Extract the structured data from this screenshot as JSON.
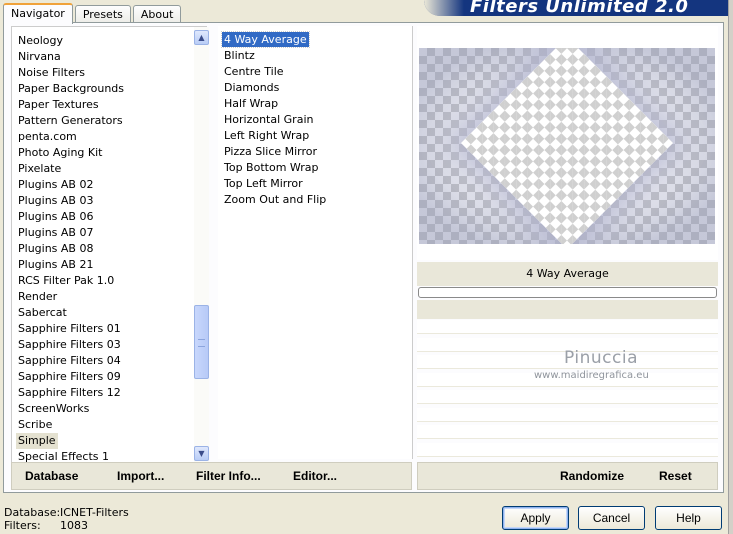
{
  "banner": {
    "title": "Filters Unlimited 2.0"
  },
  "tabs": [
    {
      "label": "Navigator"
    },
    {
      "label": "Presets"
    },
    {
      "label": "About"
    }
  ],
  "categories": {
    "items": [
      "Neology",
      "Nirvana",
      "Noise Filters",
      "Paper Backgrounds",
      "Paper Textures",
      "Pattern Generators",
      "penta.com",
      "Photo Aging Kit",
      "Pixelate",
      "Plugins AB 02",
      "Plugins AB 03",
      "Plugins AB 06",
      "Plugins AB 07",
      "Plugins AB 08",
      "Plugins AB 21",
      "RCS Filter Pak 1.0",
      "Render",
      "Sabercat",
      "Sapphire Filters 01",
      "Sapphire Filters 03",
      "Sapphire Filters 04",
      "Sapphire Filters 09",
      "Sapphire Filters 12",
      "ScreenWorks",
      "Scribe",
      "Simple",
      "Special Effects 1"
    ],
    "selected": "Simple"
  },
  "filters": {
    "items": [
      "4 Way Average",
      "Blintz",
      "Centre Tile",
      "Diamonds",
      "Half Wrap",
      "Horizontal Grain",
      "Left Right Wrap",
      "Pizza Slice Mirror",
      "Top Bottom Wrap",
      "Top Left Mirror",
      "Zoom Out and Flip"
    ],
    "selected": "4 Way Average"
  },
  "preview": {
    "filter_name": "4 Way Average",
    "watermark_title": "Pinuccia",
    "watermark_url": "www.maidiregrafica.eu"
  },
  "toolbar_left": {
    "database": "Database",
    "import": "Import...",
    "filter_info": "Filter Info...",
    "editor": "Editor..."
  },
  "toolbar_right": {
    "randomize": "Randomize",
    "reset": "Reset"
  },
  "status": {
    "database_label": "Database:",
    "database_value": "ICNET-Filters",
    "filters_label": "Filters:",
    "filters_value": "1083"
  },
  "dialog_buttons": {
    "apply": "Apply",
    "cancel": "Cancel",
    "help": "Help"
  },
  "colors": {
    "banner": "#14357f",
    "selection": "#316ac5",
    "panel": "#ece9d8"
  }
}
